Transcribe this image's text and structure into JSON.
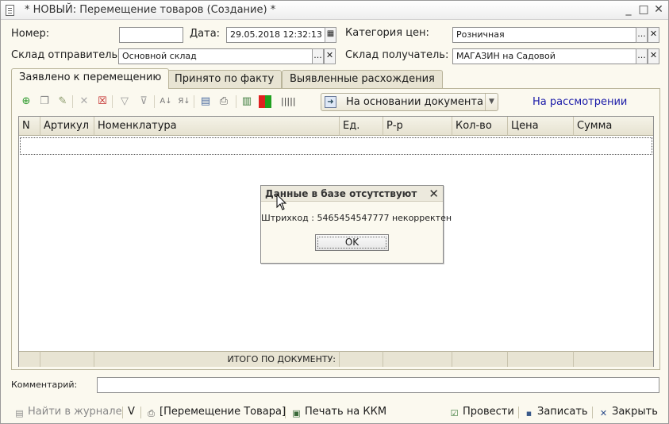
{
  "window": {
    "title": "* НОВЫЙ: Перемещение товаров (Создание) *",
    "minimize": "_",
    "maximize": "□",
    "close": "✕"
  },
  "header": {
    "number_label": "Номер:",
    "number_value": "",
    "date_label": "Дата:",
    "date_value": "29.05.2018 12:32:13",
    "price_category_label": "Категория цен:",
    "price_category_value": "Розничная",
    "sender_label": "Склад отправитель:",
    "sender_value": "Основной склад",
    "receiver_label": "Склад получатель:",
    "receiver_value": "МАГАЗИН на Садовой",
    "select_glyph": "...",
    "clear_glyph": "✕"
  },
  "tabs": [
    {
      "label": "Заявлено к перемещению",
      "active": true
    },
    {
      "label": "Принято по факту",
      "active": false
    },
    {
      "label": "Выявленные расхождения",
      "active": false
    }
  ],
  "toolbar": {
    "based_on_label": "На основании документа",
    "status_link": "На рассмотрении",
    "icons": [
      "add-icon",
      "copy-icon",
      "edit-icon",
      "delete-icon",
      "mark-delete-icon",
      "filter-icon",
      "clear-filter-icon",
      "sort-asc-icon",
      "sort-desc-icon",
      "fill-icon",
      "print-icon",
      "structure-icon",
      "color-icon",
      "barcode-icon"
    ]
  },
  "table": {
    "columns": [
      "N",
      "Артикул",
      "Номенклатура",
      "Ед.",
      "Р-р",
      "Кол-во",
      "Цена",
      "Сумма"
    ],
    "rows": [],
    "footer_total_label": "ИТОГО ПО ДОКУМЕНТУ:"
  },
  "dialog": {
    "title": "Данные в базе отсутствуют",
    "close": "✕",
    "message": "Штрихкод : 5465454547777 некорректен",
    "ok_label": "OK"
  },
  "comment": {
    "label": "Комментарий:",
    "value": ""
  },
  "bottom_bar": {
    "find_in_journal": "Найти в журнале",
    "v_label": "V",
    "print_movement": "[Перемещение Товара]",
    "print_kkm": "Печать на ККМ",
    "post": "Провести",
    "save": "Записать",
    "close": "Закрыть"
  },
  "colors": {
    "background": "#fbf9ef",
    "tab_inactive": "#e8e4d3",
    "link": "#1a1aa8"
  }
}
